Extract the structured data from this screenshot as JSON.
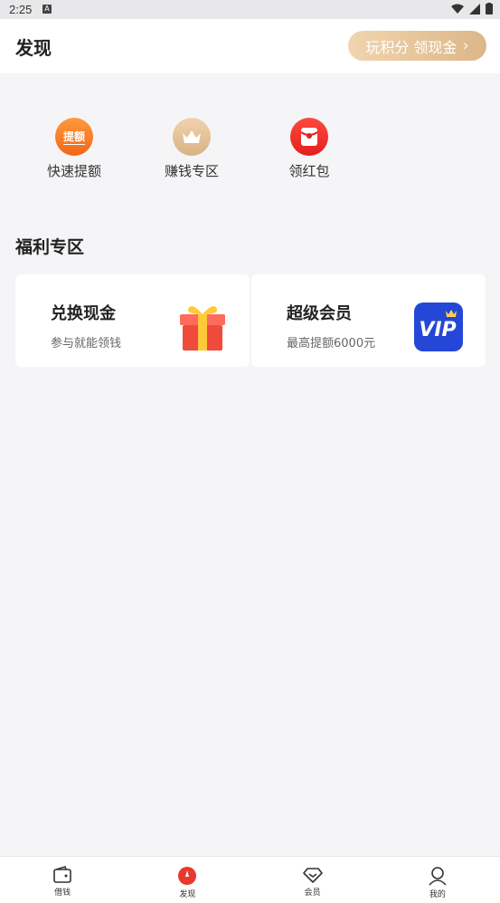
{
  "status": {
    "time": "2:25"
  },
  "header": {
    "title": "发现",
    "points_button": "玩积分 领现金"
  },
  "quick": [
    {
      "label": "快速提额",
      "icon": "quota-icon",
      "icon_text": "提额"
    },
    {
      "label": "赚钱专区",
      "icon": "crown-icon"
    },
    {
      "label": "领红包",
      "icon": "red-packet-icon"
    }
  ],
  "section": {
    "title": "福利专区"
  },
  "cards": [
    {
      "title": "兑换现金",
      "subtitle": "参与就能领钱",
      "icon": "gift-icon"
    },
    {
      "title": "超级会员",
      "subtitle": "最高提额6000元",
      "icon": "vip-icon"
    }
  ],
  "tabs": [
    {
      "label": "借钱",
      "icon": "wallet-icon"
    },
    {
      "label": "发现",
      "icon": "compass-icon",
      "active": true
    },
    {
      "label": "会员",
      "icon": "diamond-icon"
    },
    {
      "label": "我的",
      "icon": "user-icon"
    }
  ],
  "colors": {
    "accent": "#e8392f",
    "gold": "#dcb688",
    "vip": "#1f3fd1"
  }
}
